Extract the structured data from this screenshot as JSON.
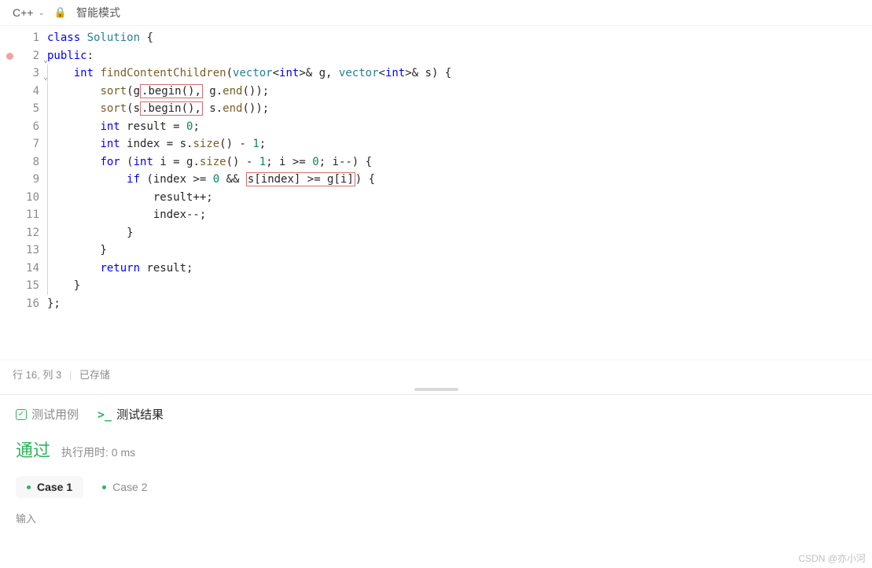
{
  "topbar": {
    "language": "C++",
    "mode": "智能模式"
  },
  "code_lines": [
    {
      "n": 1,
      "tokens": [
        {
          "t": "class ",
          "c": "kw"
        },
        {
          "t": "Solution",
          "c": "cname"
        },
        {
          "t": " {"
        }
      ]
    },
    {
      "n": 2,
      "bp": true,
      "fold": true,
      "tokens": [
        {
          "t": "public",
          "c": "kw"
        },
        {
          "t": ":"
        }
      ]
    },
    {
      "n": 3,
      "fold": true,
      "guide": [
        0
      ],
      "tokens": [
        {
          "t": "    "
        },
        {
          "t": "int ",
          "c": "kw"
        },
        {
          "t": "findContentChildren",
          "c": "func"
        },
        {
          "t": "("
        },
        {
          "t": "vector",
          "c": "type"
        },
        {
          "t": "<"
        },
        {
          "t": "int",
          "c": "kw"
        },
        {
          "t": ">& g, "
        },
        {
          "t": "vector",
          "c": "type"
        },
        {
          "t": "<"
        },
        {
          "t": "int",
          "c": "kw"
        },
        {
          "t": ">& s) {"
        }
      ]
    },
    {
      "n": 4,
      "guide": [
        0
      ],
      "tokens": [
        {
          "t": "        "
        },
        {
          "t": "sort",
          "c": "func"
        },
        {
          "t": "(g"
        },
        {
          "t": ".begin(),",
          "c": "",
          "box": true
        },
        {
          "t": " g."
        },
        {
          "t": "end",
          "c": "func"
        },
        {
          "t": "());"
        }
      ]
    },
    {
      "n": 5,
      "guide": [
        0
      ],
      "tokens": [
        {
          "t": "        "
        },
        {
          "t": "sort",
          "c": "func"
        },
        {
          "t": "(s"
        },
        {
          "t": ".begin(),",
          "c": "",
          "box": true
        },
        {
          "t": " s."
        },
        {
          "t": "end",
          "c": "func"
        },
        {
          "t": "());"
        }
      ]
    },
    {
      "n": 6,
      "guide": [
        0
      ],
      "tokens": [
        {
          "t": "        "
        },
        {
          "t": "int ",
          "c": "kw"
        },
        {
          "t": "result = "
        },
        {
          "t": "0",
          "c": "num"
        },
        {
          "t": ";"
        }
      ]
    },
    {
      "n": 7,
      "guide": [
        0
      ],
      "tokens": [
        {
          "t": "        "
        },
        {
          "t": "int ",
          "c": "kw"
        },
        {
          "t": "index = s."
        },
        {
          "t": "size",
          "c": "func"
        },
        {
          "t": "() - "
        },
        {
          "t": "1",
          "c": "num"
        },
        {
          "t": ";"
        }
      ]
    },
    {
      "n": 8,
      "guide": [
        0
      ],
      "tokens": [
        {
          "t": "        "
        },
        {
          "t": "for ",
          "c": "kw"
        },
        {
          "t": "("
        },
        {
          "t": "int ",
          "c": "kw"
        },
        {
          "t": "i = g."
        },
        {
          "t": "size",
          "c": "func"
        },
        {
          "t": "() - "
        },
        {
          "t": "1",
          "c": "num"
        },
        {
          "t": "; i >= "
        },
        {
          "t": "0",
          "c": "num"
        },
        {
          "t": "; i--) {"
        }
      ]
    },
    {
      "n": 9,
      "guide": [
        0
      ],
      "tokens": [
        {
          "t": "            "
        },
        {
          "t": "if ",
          "c": "kw"
        },
        {
          "t": "(index >= "
        },
        {
          "t": "0",
          "c": "num"
        },
        {
          "t": " && "
        },
        {
          "t": "s[index] >= g[i]",
          "box": true
        },
        {
          "t": ") {"
        }
      ]
    },
    {
      "n": 10,
      "guide": [
        0
      ],
      "tokens": [
        {
          "t": "                result++;"
        }
      ]
    },
    {
      "n": 11,
      "guide": [
        0
      ],
      "tokens": [
        {
          "t": "                index--;"
        }
      ]
    },
    {
      "n": 12,
      "guide": [
        0
      ],
      "tokens": [
        {
          "t": "            }"
        }
      ]
    },
    {
      "n": 13,
      "guide": [
        0
      ],
      "tokens": [
        {
          "t": "        }"
        }
      ]
    },
    {
      "n": 14,
      "guide": [
        0
      ],
      "tokens": [
        {
          "t": "        "
        },
        {
          "t": "return ",
          "c": "kw"
        },
        {
          "t": "result;"
        }
      ]
    },
    {
      "n": 15,
      "guide": [
        0
      ],
      "tokens": [
        {
          "t": "    }"
        }
      ]
    },
    {
      "n": 16,
      "tokens": [
        {
          "t": "};"
        }
      ]
    }
  ],
  "status": {
    "row_label": "行",
    "row": "16",
    "col_label": "列",
    "col": "3",
    "saved": "已存储"
  },
  "results": {
    "tab_testcase": "测试用例",
    "tab_result": "测试结果",
    "pass": "通过",
    "runtime": "执行用时: 0 ms",
    "cases": [
      "Case 1",
      "Case 2"
    ],
    "input_label": "输入"
  },
  "watermark": "CSDN @亦小河"
}
